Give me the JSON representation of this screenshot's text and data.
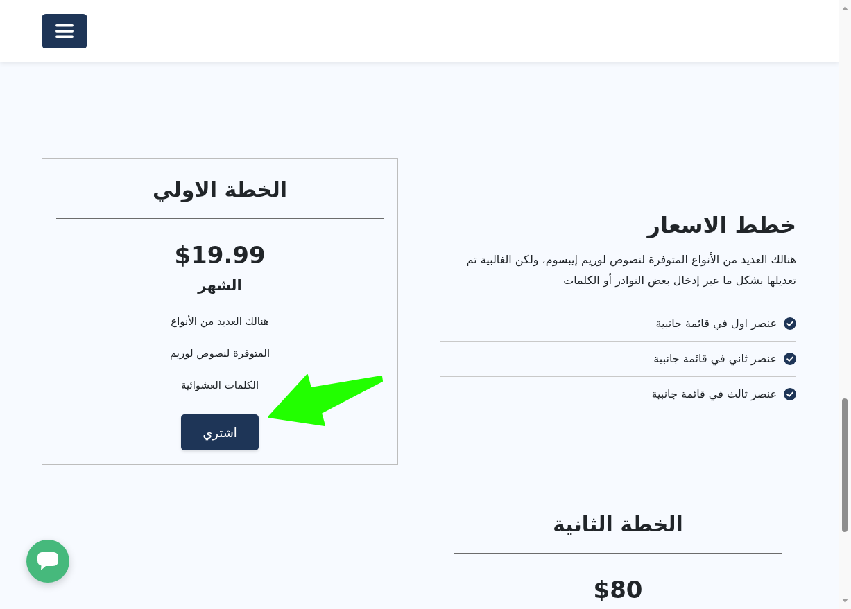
{
  "intro": {
    "title": "خطط الاسعار",
    "text": "هنالك العديد من الأنواع المتوفرة لنصوص لوريم إيبسوم، ولكن الغالبية تم تعديلها بشكل ما عبر إدخال بعض النوادر أو الكلمات",
    "features": [
      "عنصر اول في قائمة جانبية",
      "عنصر ثاني في قائمة جانبية",
      "عنصر ثالث في قائمة جانبية"
    ]
  },
  "plans": [
    {
      "title": "الخطة الاولي",
      "price": "$19.99",
      "period": "الشهر",
      "lines": [
        "هنالك العديد من الأنواع",
        "المتوفرة لنصوص لوريم",
        "الكلمات العشوائية"
      ],
      "button": "اشتري"
    },
    {
      "title": "الخطة الثانية",
      "price": "$80"
    }
  ]
}
